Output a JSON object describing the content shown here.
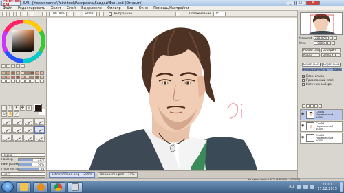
{
  "window": {
    "app_logo": "PaintTool SAI",
    "title": "SAI - [Новая папка\\Paint tool\\Раскраска\\Saидай\\Фон.psd (Открыт)]",
    "minimize": "_",
    "maximize": "□",
    "close": "✕"
  },
  "menu": [
    "Файл",
    "Редактировать",
    "Холст",
    "Слой",
    "Выделение",
    "Фильтр",
    "Вид",
    "Окно",
    "Помощь/Настройки"
  ],
  "toolbar": {
    "zoom": "100.00%",
    "angle": "+000°",
    "selection_label": "Выбранное",
    "smoothing_label": "Сглаживание",
    "smoothing_value": "15"
  },
  "colors": {
    "swatches": [
      [
        "#d8b99a",
        "#c79b7a",
        "#a36d54",
        "#e7c9b3",
        "#f0d9c7",
        "#b58368",
        "#8a5a44",
        "#d7a58b",
        "#f1b3a1"
      ],
      [
        "#caa089",
        "#e1a08c",
        "#c26e5f",
        "#a1544a",
        "#ddb3a2",
        "#f3d2c2",
        "#b38778",
        "#8f6b5e",
        "#e2c2b3"
      ],
      [
        "#ffffff",
        "#ffffff",
        "#ffffff",
        "#ffffff",
        "#ffffff",
        "#ffffff",
        "#ffffff",
        "#ffffff",
        "#ffffff"
      ]
    ],
    "foreground": "#24150f",
    "accent": "#6a7eb6"
  },
  "brushes": [
    "Кисть",
    "Аэрогр.",
    "Кисть",
    "Маркер",
    "Акварель",
    "Размыт.",
    "Ластик",
    "Выделит.",
    "Ластик",
    "Карандаш",
    "Заливка",
    "Стан."
  ],
  "brush_props": {
    "mode": "Норма",
    "size_label": "Размер",
    "size_mult": "x1.0",
    "size_value": "21.0",
    "min_size_label": "Мин размер",
    "min_size_value": "50%",
    "density_label": "Плотность",
    "density_value": "79",
    "shape_label": "[нет]",
    "texture_label": "[нет]",
    "blend_label": "Смешивание цвета",
    "blend_value": "90",
    "dilution_label": "Растушёвка цвета",
    "dilution_value": "61",
    "fill": {
      "size": 0.55,
      "min_size": 0.5,
      "density": 0.79,
      "blend": 0.9,
      "dilution": 0.61
    }
  },
  "right": {
    "zoom_label": "Масштаб",
    "zoom_value": "285.07%",
    "angle_label": "Угол",
    "angle_value": "+000.0",
    "btn_new_layer": "Новый слой",
    "btn_combine": "Объедин.",
    "btn_mask": "Маска",
    "btn_clear": "Очистить",
    "texture": "Текстура",
    "texture_value": "Нормальная",
    "effect": "Эффект",
    "effect_value": "Нормальная",
    "opacity_label": "Непрозрачность",
    "opacity_value": "100%",
    "blend_mode": "Нормальный",
    "check1": "Блок. альфа",
    "check2": "Привязанный слой",
    "check3": "Источник выбора",
    "layers": [
      {
        "name": "Слой4",
        "mode": "Нормальный",
        "opacity": "100%"
      },
      {
        "name": "Слой3",
        "mode": "Нормальный",
        "opacity": "100%"
      },
      {
        "name": "Слой1",
        "mode": "Нормальный",
        "opacity": "100%"
      }
    ]
  },
  "doctabs": [
    {
      "name": "setnewfifipad.png",
      "zoom": "285%"
    },
    {
      "name": "beauneme.psd",
      "zoom": "71%"
    }
  ],
  "status": "Загрузка памяти 67% (1489МБ / 3979МБ)",
  "taskbar": {
    "lang": "RU",
    "time": "21:01",
    "date": "17.12.2015"
  }
}
